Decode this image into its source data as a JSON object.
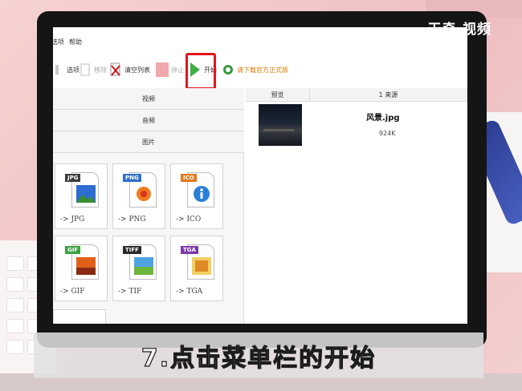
{
  "watermark": "天奇·视频",
  "menu": {
    "items": [
      "选项",
      "帮助"
    ]
  },
  "toolbar": {
    "options_label": "选项",
    "remove_label": "移除",
    "clear_label": "清空列表",
    "stop_label": "停止",
    "start_label": "开始",
    "download_label": "请下载官方正式版",
    "highlight_color": "#e0161d"
  },
  "left_pane": {
    "categories": [
      "视频",
      "音频",
      "图片"
    ],
    "formats": [
      {
        "badge": "JPG",
        "label": "-> JPG",
        "badge_color": "#3a3a3a"
      },
      {
        "badge": "PNG",
        "label": "-> PNG",
        "badge_color": "#2f6fc9"
      },
      {
        "badge": "ICO",
        "label": "-> ICO",
        "badge_color": "#e07a1a"
      },
      {
        "badge": "GIF",
        "label": "-> GIF",
        "badge_color": "#3aa040"
      },
      {
        "badge": "TIFF",
        "label": "-> TIF",
        "badge_color": "#2a2a2a"
      },
      {
        "badge": "TGA",
        "label": "-> TGA",
        "badge_color": "#7b3aa8"
      }
    ]
  },
  "right_pane": {
    "columns": [
      "预览",
      "1 来源"
    ],
    "file": {
      "name": "风景.jpg",
      "size": "924K"
    }
  },
  "subtitle": "7.点击菜单栏的开始"
}
